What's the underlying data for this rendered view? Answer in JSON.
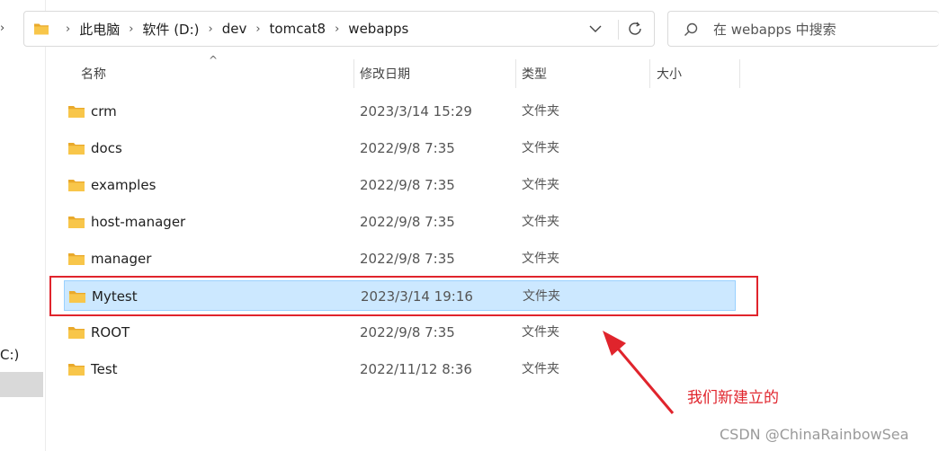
{
  "nav_pane": {
    "drive_fragment": "C:)"
  },
  "address_bar": {
    "breadcrumbs": [
      "此电脑",
      "软件 (D:)",
      "dev",
      "tomcat8",
      "webapps"
    ]
  },
  "search": {
    "placeholder": "在 webapps 中搜索"
  },
  "columns": {
    "name": "名称",
    "modified": "修改日期",
    "type": "类型",
    "size": "大小"
  },
  "files": [
    {
      "name": "crm",
      "modified": "2023/3/14 15:29",
      "type": "文件夹",
      "selected": false
    },
    {
      "name": "docs",
      "modified": "2022/9/8 7:35",
      "type": "文件夹",
      "selected": false
    },
    {
      "name": "examples",
      "modified": "2022/9/8 7:35",
      "type": "文件夹",
      "selected": false
    },
    {
      "name": "host-manager",
      "modified": "2022/9/8 7:35",
      "type": "文件夹",
      "selected": false
    },
    {
      "name": "manager",
      "modified": "2022/9/8 7:35",
      "type": "文件夹",
      "selected": false
    },
    {
      "name": "Mytest",
      "modified": "2023/3/14 19:16",
      "type": "文件夹",
      "selected": true
    },
    {
      "name": "ROOT",
      "modified": "2022/9/8 7:35",
      "type": "文件夹",
      "selected": false
    },
    {
      "name": "Test",
      "modified": "2022/11/12 8:36",
      "type": "文件夹",
      "selected": false
    }
  ],
  "annotation": {
    "text": "我们新建立的",
    "color": "#e0242c"
  },
  "watermark": "CSDN @ChinaRainbowSea",
  "colors": {
    "selection_bg": "#cce8ff",
    "selection_border": "#99d1ff",
    "folder_yellow": "#f8c64a"
  }
}
